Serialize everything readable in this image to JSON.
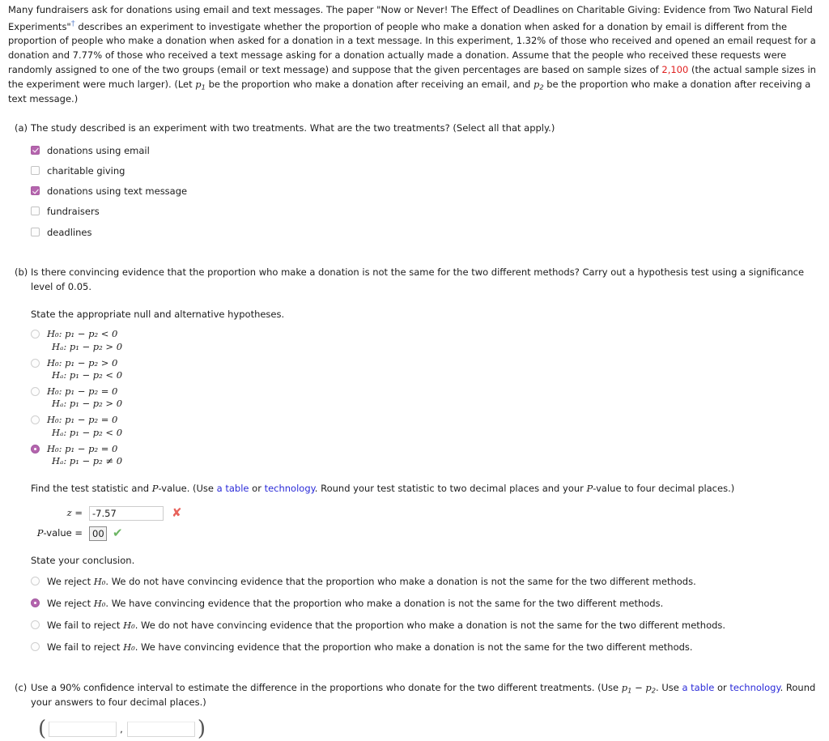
{
  "intro": {
    "text_part1": "Many fundraisers ask for donations using email and text messages. The paper \"Now or Never! The Effect of Deadlines on Charitable Giving: Evidence from Two Natural Field Experiments\"",
    "footnote_marker": "†",
    "text_part2": " describes an experiment to investigate whether the proportion of people who make a donation when asked for a donation by email is different from the proportion of people who make a donation when asked for a donation in a text message. In this experiment, 1.32% of those who received and opened an email request for a donation and 7.77% of those who received a text message asking for a donation actually made a donation. Assume that the people who received these requests were randomly assigned to one of the two groups (email or text message) and suppose that the given percentages are based on sample sizes of ",
    "sample_size": "2,100",
    "text_part3": " (the actual sample sizes in the experiment were much larger). (Let ",
    "p1": "p",
    "p1_sub": "1",
    "text_part4": " be the proportion who make a donation after receiving an email, and ",
    "p2": "p",
    "p2_sub": "2",
    "text_part5": " be the proportion who make a donation after receiving a text message.)"
  },
  "part_a": {
    "label": "(a)",
    "prompt": "The study described is an experiment with two treatments. What are the two treatments? (Select all that apply.)",
    "options": [
      {
        "label": "donations using email",
        "checked": true
      },
      {
        "label": "charitable giving",
        "checked": false
      },
      {
        "label": "donations using text message",
        "checked": true
      },
      {
        "label": "fundraisers",
        "checked": false
      },
      {
        "label": "deadlines",
        "checked": false
      }
    ]
  },
  "part_b": {
    "label": "(b)",
    "prompt": "Is there convincing evidence that the proportion who make a donation is not the same for the two different methods? Carry out a hypothesis test using a significance level of 0.05.",
    "hypotheses_prompt": "State the appropriate null and alternative hypotheses.",
    "hypothesis_options": [
      {
        "null": "H₀: p₁ − p₂ < 0",
        "alt": "Hₐ: p₁ − p₂ > 0",
        "null_rel": "<",
        "alt_rel": ">",
        "selected": false
      },
      {
        "null": "H₀: p₁ − p₂ > 0",
        "alt": "Hₐ: p₁ − p₂ < 0",
        "null_rel": ">",
        "alt_rel": "<",
        "selected": false
      },
      {
        "null": "H₀: p₁ − p₂ = 0",
        "alt": "Hₐ: p₁ − p₂ > 0",
        "null_rel": "=",
        "alt_rel": ">",
        "selected": false
      },
      {
        "null": "H₀: p₁ − p₂ = 0",
        "alt": "Hₐ: p₁ − p₂ < 0",
        "null_rel": "=",
        "alt_rel": "<",
        "selected": false
      },
      {
        "null": "H₀: p₁ − p₂ = 0",
        "alt": "Hₐ: p₁ − p₂ ≠ 0",
        "null_rel": "=",
        "alt_rel": "≠",
        "selected": true
      }
    ],
    "statistic_prompt_1": "Find the test statistic and ",
    "statistic_prompt_p": "P",
    "statistic_prompt_2": "-value. (Use ",
    "link_table": "a table",
    "statistic_prompt_or": " or ",
    "link_technology": "technology",
    "statistic_prompt_3": ". Round your test statistic to two decimal places and your ",
    "statistic_prompt_p2": "P",
    "statistic_prompt_4": "-value to four decimal places.)",
    "z_label": "z  =",
    "z_value": "-7.57",
    "z_mark": "✘",
    "z_mark_state": "incorrect",
    "pvalue_label": "P-value  =",
    "pvalue_value": "00",
    "pvalue_mark": "✔",
    "pvalue_mark_state": "correct",
    "conclusion_prompt": "State your conclusion.",
    "conclusion_options": [
      {
        "pre": "We reject ",
        "h": "H₀",
        "post": ". We do not have convincing evidence that the proportion who make a donation is not the same for the two different methods.",
        "selected": false
      },
      {
        "pre": "We reject ",
        "h": "H₀",
        "post": ". We have convincing evidence that the proportion who make a donation is not the same for the two different methods.",
        "selected": true
      },
      {
        "pre": "We fail to reject ",
        "h": "H₀",
        "post": ". We do not have convincing evidence that the proportion who make a donation is not the same for the two different methods.",
        "selected": false
      },
      {
        "pre": "We fail to reject ",
        "h": "H₀",
        "post": ". We have convincing evidence that the proportion who make a donation is not the same for the two different methods.",
        "selected": false
      }
    ]
  },
  "part_c": {
    "label": "(c)",
    "prompt_1": "Use a 90% confidence interval to estimate the difference in the proportions who donate for the two different treatments. (Use ",
    "p1": "p",
    "p1_sub": "1",
    "minus": " − ",
    "p2": "p",
    "p2_sub": "2",
    "prompt_2": ". Use ",
    "link_table": "a table",
    "prompt_or": " or ",
    "link_technology": "technology",
    "prompt_3": ". Round your answers to four decimal places.)",
    "lower_value": "",
    "lower_placeholder": "",
    "upper_value": "",
    "upper_placeholder": "",
    "open_paren": "(",
    "comma": ",",
    "close_paren": ")"
  },
  "colors": {
    "accent_purple": "#b565ae",
    "link_blue": "#2a2ad8",
    "red_value": "#e02020",
    "wrong_mark": "#e8635c",
    "right_mark": "#6cb563"
  }
}
